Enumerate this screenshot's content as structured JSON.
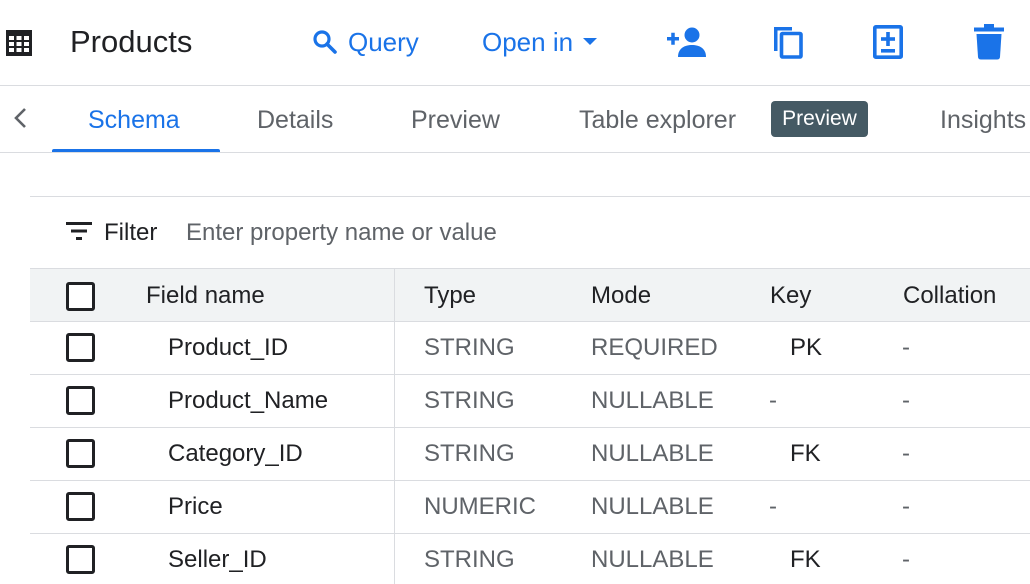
{
  "header": {
    "title": "Products",
    "query_label": "Query",
    "open_in_label": "Open in"
  },
  "tabs": [
    {
      "label": "Schema",
      "active": true
    },
    {
      "label": "Details",
      "active": false
    },
    {
      "label": "Preview",
      "active": false
    },
    {
      "label": "Table explorer",
      "active": false,
      "badge": "Preview"
    },
    {
      "label": "Insights",
      "active": false
    }
  ],
  "filter": {
    "label": "Filter",
    "placeholder": "Enter property name or value"
  },
  "table": {
    "columns": [
      "Field name",
      "Type",
      "Mode",
      "Key",
      "Collation"
    ],
    "rows": [
      {
        "name": "Product_ID",
        "type": "STRING",
        "mode": "REQUIRED",
        "key": "PK",
        "collation": "-"
      },
      {
        "name": "Product_Name",
        "type": "STRING",
        "mode": "NULLABLE",
        "key": "-",
        "collation": "-"
      },
      {
        "name": "Category_ID",
        "type": "STRING",
        "mode": "NULLABLE",
        "key": "FK",
        "collation": "-"
      },
      {
        "name": "Price",
        "type": "NUMERIC",
        "mode": "NULLABLE",
        "key": "-",
        "collation": "-"
      },
      {
        "name": "Seller_ID",
        "type": "STRING",
        "mode": "NULLABLE",
        "key": "FK",
        "collation": "-"
      }
    ]
  },
  "colors": {
    "accent": "#1a73e8",
    "badge_bg": "#455a64",
    "header_row_bg": "#f1f3f4",
    "divider": "#dadce0"
  },
  "icons": [
    "table-icon",
    "search-icon",
    "dropdown-caret-icon",
    "share-person-add-icon",
    "copy-icon",
    "snapshot-add-icon",
    "delete-icon",
    "chevron-left-icon",
    "filter-icon"
  ]
}
